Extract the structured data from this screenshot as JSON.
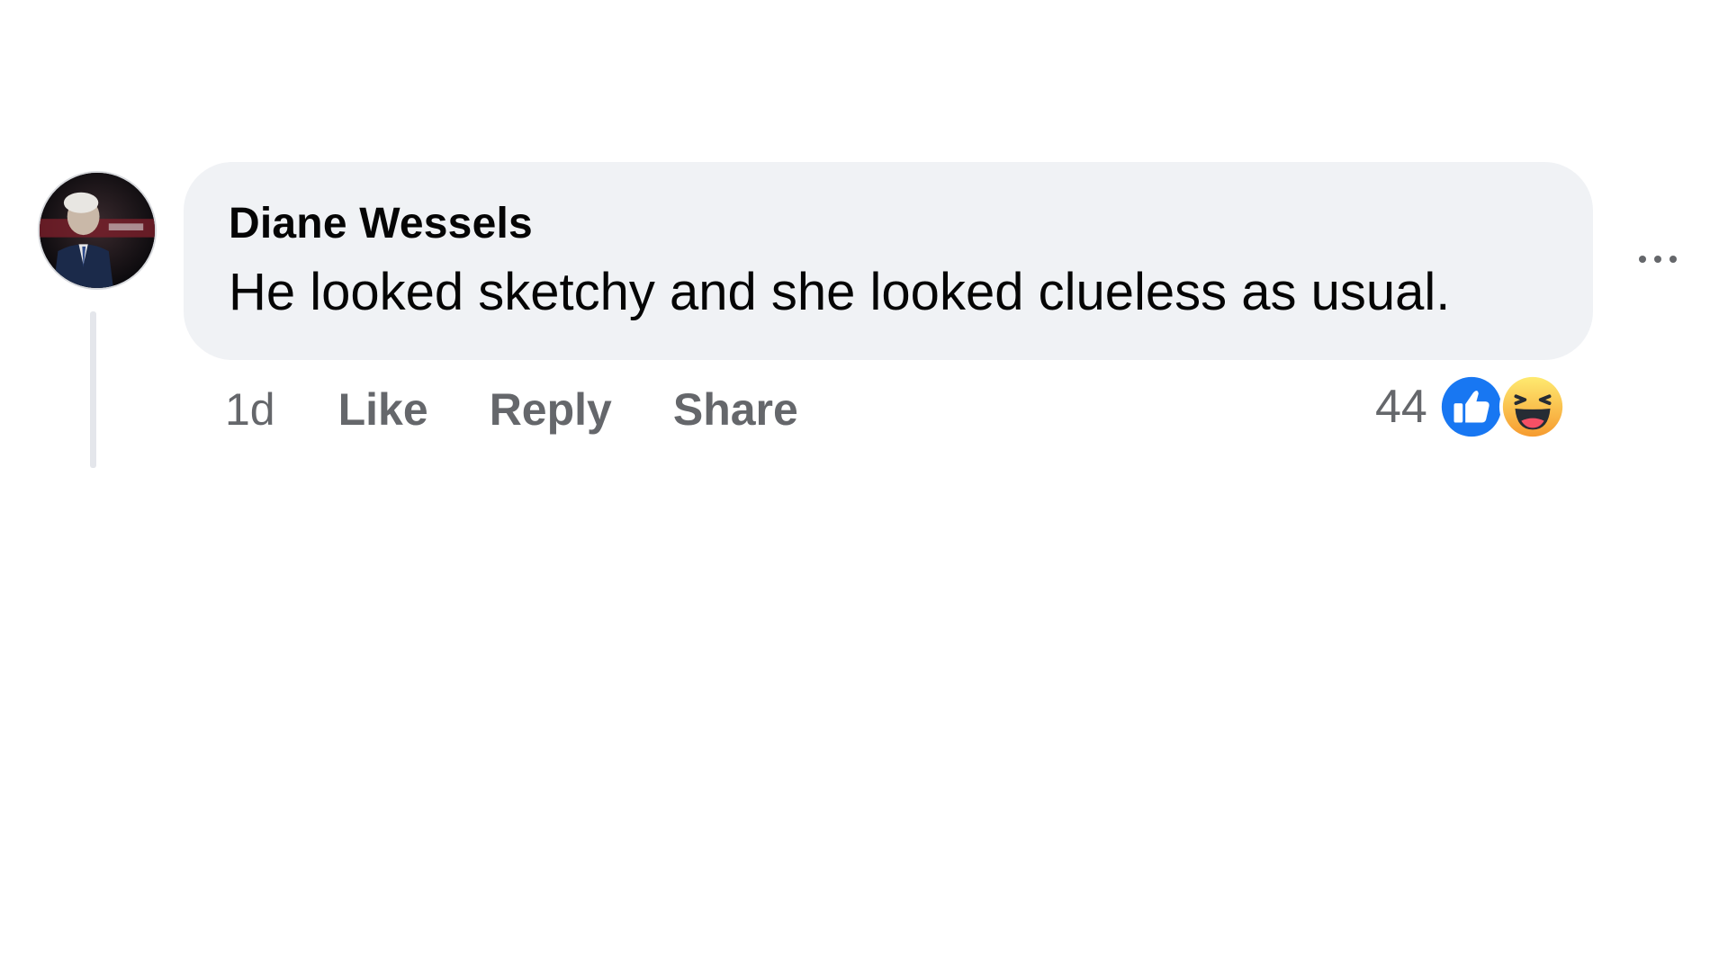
{
  "comment": {
    "author": "Diane Wessels",
    "text": "He looked sketchy and she looked clueless as usual.",
    "time": "1d",
    "actions": {
      "like": "Like",
      "reply": "Reply",
      "share": "Share"
    },
    "reactions": {
      "count": "44",
      "icons": [
        "like-icon",
        "haha-icon"
      ]
    },
    "more_icon": "more-options-icon"
  },
  "colors": {
    "bubble": "#f0f2f5",
    "secondary_text": "#65676b",
    "like_blue": "#1877f2",
    "haha_yellow": "#f7b125"
  }
}
